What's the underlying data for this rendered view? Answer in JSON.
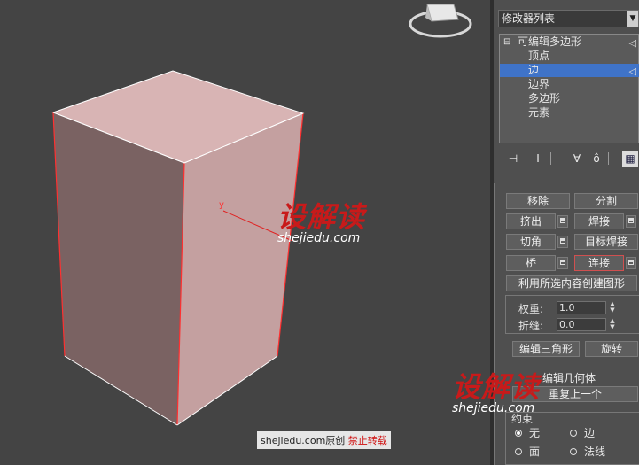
{
  "viewport": {
    "gizmo_label": "y"
  },
  "watermarks": [
    {
      "brand": "设解读",
      "site": "shejiedu.com"
    },
    {
      "brand": "设解读",
      "site": "shejiedu.com"
    }
  ],
  "credit": {
    "site": "shejiedu.com原创",
    "notice": "禁止转载"
  },
  "panel": {
    "modifier_list": "修改器列表",
    "stack": {
      "root": "可编辑多边形",
      "items": [
        "顶点",
        "边",
        "边界",
        "多边形",
        "元素"
      ],
      "selected_index": 1
    },
    "edit_edges": {
      "remove": "移除",
      "split": "分割",
      "extrude": "挤出",
      "weld": "焊接",
      "chamfer": "切角",
      "target_weld": "目标焊接",
      "bridge": "桥",
      "connect": "连接",
      "create_shape": "利用所选内容创建图形",
      "weight_label": "权重:",
      "weight_value": "1.0",
      "crease_label": "折缝:",
      "crease_value": "0.0",
      "edit_tri": "编辑三角形",
      "turn": "旋转"
    },
    "edit_geometry": {
      "title": "编辑几何体",
      "repeat_last": "重复上一个",
      "constraints_label": "约束",
      "none": "无",
      "edge": "边",
      "face": "面",
      "normal": "法线",
      "selected_constraint": "none"
    }
  }
}
